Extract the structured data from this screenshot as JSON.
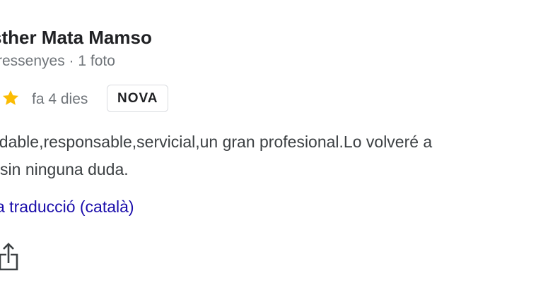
{
  "review": {
    "author_name": "sther Mata Mamso",
    "author_meta": "ressenyes · 1 foto",
    "rating_icon": "star-icon",
    "date": "fa 4 dies",
    "badge": "NOVA",
    "text_lines": [
      "adable,responsable,servicial,un gran profesional.Lo volveré a",
      "r sin ninguna duda."
    ],
    "translation_link": "a traducció (català)",
    "share_icon": "share-icon"
  },
  "colors": {
    "star": "#fbbc04",
    "link": "#1a0dab",
    "muted": "#70757a",
    "text": "#3c4043",
    "badge_border": "#dadce0"
  }
}
